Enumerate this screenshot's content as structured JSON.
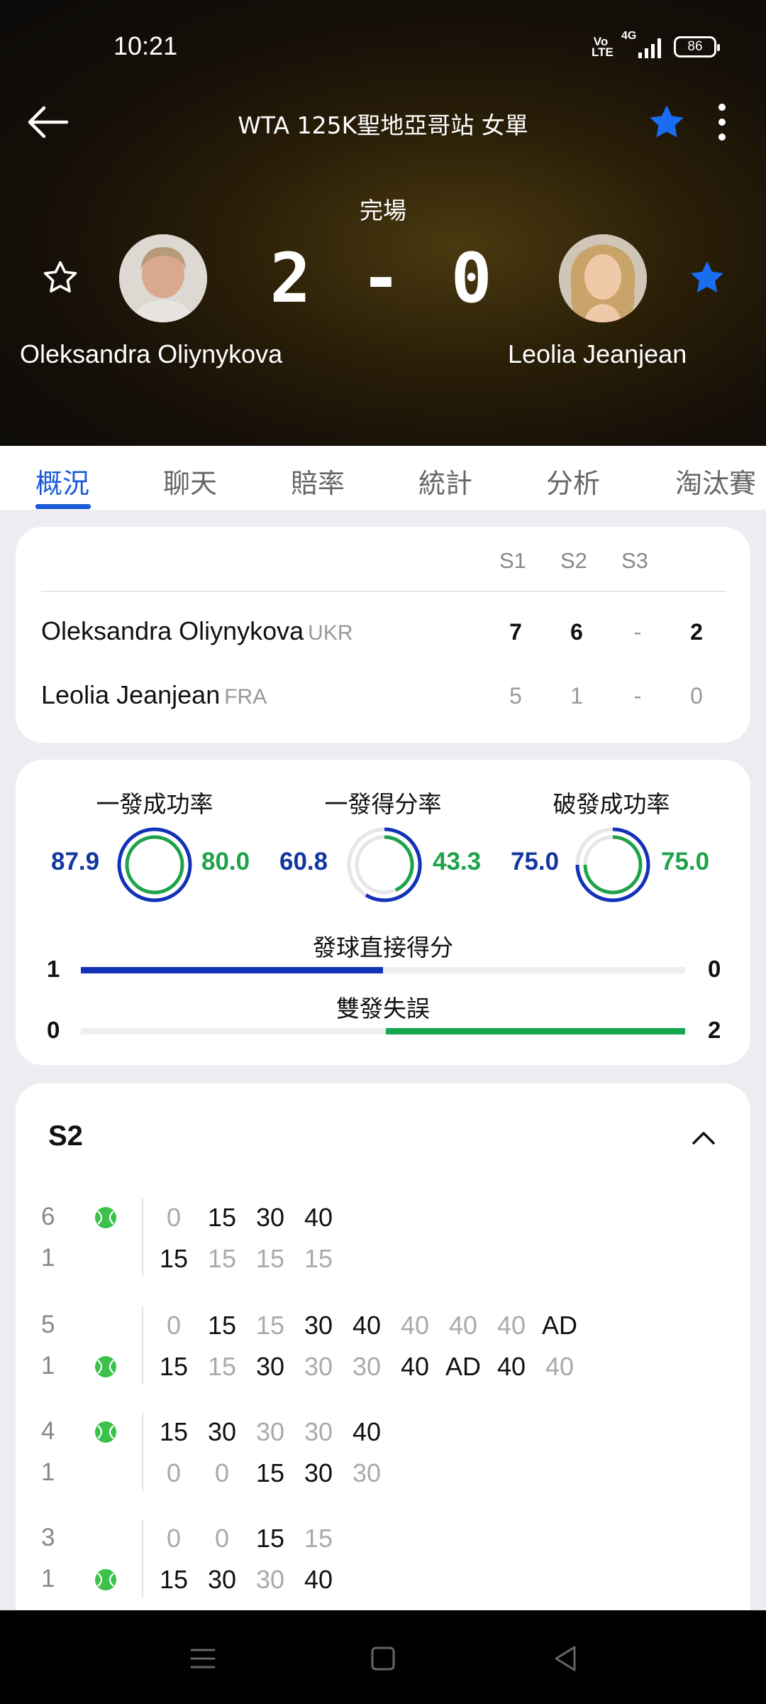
{
  "status_bar": {
    "time": "10:21",
    "volte": "Vo LTE",
    "network": "4G",
    "battery": "86"
  },
  "header": {
    "title": "WTA 125K聖地亞哥站 女單",
    "status": "完場",
    "score": "2 - 0",
    "player1": "Oleksandra Oliynykova",
    "player2": "Leolia Jeanjean"
  },
  "tabs": [
    "概況",
    "聊天",
    "賠率",
    "統計",
    "分析",
    "淘汰賽"
  ],
  "scoreboard": {
    "headers": [
      "S1",
      "S2",
      "S3"
    ],
    "rows": [
      {
        "name": "Oleksandra Oliynykova",
        "country": "UKR",
        "sets": [
          "7",
          "6",
          "-"
        ],
        "total": "2"
      },
      {
        "name": "Leolia Jeanjean",
        "country": "FRA",
        "sets": [
          "5",
          "1",
          "-"
        ],
        "total": "0"
      }
    ]
  },
  "stats": {
    "circles": [
      {
        "label": "一發成功率",
        "left": "87.9",
        "right": "80.0"
      },
      {
        "label": "一發得分率",
        "left": "60.8",
        "right": "43.3"
      },
      {
        "label": "破發成功率",
        "left": "75.0",
        "right": "75.0"
      }
    ],
    "bars": [
      {
        "label": "發球直接得分",
        "left": "1",
        "right": "0"
      },
      {
        "label": "雙發失誤",
        "left": "0",
        "right": "2"
      }
    ]
  },
  "points": {
    "set_label": "S2",
    "games": [
      {
        "top_game": "6",
        "bottom_game": "1",
        "top_points": [
          "0",
          "15",
          "30",
          "40"
        ],
        "bottom_points": [
          "15",
          "15",
          "15",
          "15"
        ]
      },
      {
        "top_game": "5",
        "bottom_game": "1",
        "top_points": [
          "0",
          "15",
          "15",
          "30",
          "40",
          "40",
          "40",
          "40",
          "AD"
        ],
        "bottom_points": [
          "15",
          "15",
          "30",
          "30",
          "30",
          "40",
          "AD",
          "40",
          "40"
        ]
      },
      {
        "top_game": "4",
        "bottom_game": "1",
        "top_points": [
          "15",
          "30",
          "30",
          "30",
          "40"
        ],
        "bottom_points": [
          "0",
          "0",
          "15",
          "30",
          "30"
        ]
      },
      {
        "top_game": "3",
        "bottom_game": "1",
        "top_points": [
          "0",
          "0",
          "15",
          "15"
        ],
        "bottom_points": [
          "15",
          "30",
          "30",
          "40"
        ]
      }
    ]
  },
  "colors": {
    "accent": "#1a5bd8",
    "player1": "#1237a0",
    "player2": "#1ea34a",
    "favorite": "#1a6cf0"
  }
}
